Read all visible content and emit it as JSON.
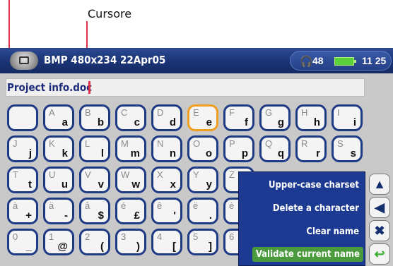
{
  "annotation": {
    "cursor_label": "Cursore",
    "color": "#e0304a"
  },
  "titlebar": {
    "title": "BMP 480x234 22Apr05",
    "volume": "48",
    "time": "11 25",
    "icons": {
      "logo": "archos-logo-icon",
      "headphones": "headphones-icon",
      "battery": "battery-icon"
    }
  },
  "namebar": {
    "filename": "Project info.doc"
  },
  "keyboard": {
    "rows": [
      [
        {
          "up": "",
          "lo": ""
        },
        {
          "up": "A",
          "lo": "a"
        },
        {
          "up": "B",
          "lo": "b"
        },
        {
          "up": "C",
          "lo": "c"
        },
        {
          "up": "D",
          "lo": "d"
        },
        {
          "up": "E",
          "lo": "e",
          "selected": true
        },
        {
          "up": "F",
          "lo": "f"
        },
        {
          "up": "G",
          "lo": "g"
        },
        {
          "up": "H",
          "lo": "h"
        },
        {
          "up": "I",
          "lo": "i"
        }
      ],
      [
        {
          "up": "J",
          "lo": "j"
        },
        {
          "up": "K",
          "lo": "k"
        },
        {
          "up": "L",
          "lo": "l"
        },
        {
          "up": "M",
          "lo": "m"
        },
        {
          "up": "N",
          "lo": "n"
        },
        {
          "up": "O",
          "lo": "o"
        },
        {
          "up": "P",
          "lo": "p"
        },
        {
          "up": "Q",
          "lo": "q"
        },
        {
          "up": "R",
          "lo": "r"
        },
        {
          "up": "S",
          "lo": "s"
        }
      ],
      [
        {
          "up": "T",
          "lo": "t"
        },
        {
          "up": "U",
          "lo": "u"
        },
        {
          "up": "V",
          "lo": "v"
        },
        {
          "up": "W",
          "lo": "w"
        },
        {
          "up": "X",
          "lo": "x"
        },
        {
          "up": "Y",
          "lo": "y"
        },
        {
          "up": "Z",
          "lo": ""
        }
      ],
      [
        {
          "up": "à",
          "lo": "+"
        },
        {
          "up": "ä",
          "lo": "-"
        },
        {
          "up": "â",
          "lo": "$"
        },
        {
          "up": "é",
          "lo": "£"
        },
        {
          "up": "ê",
          "lo": "'"
        },
        {
          "up": "ë",
          "lo": "."
        },
        {
          "up": "è",
          "lo": ""
        }
      ],
      [
        {
          "up": "0",
          "lo": "_"
        },
        {
          "up": "1",
          "lo": "@"
        },
        {
          "up": "2",
          "lo": "("
        },
        {
          "up": "3",
          "lo": ")"
        },
        {
          "up": "4",
          "lo": "["
        },
        {
          "up": "5",
          "lo": "]"
        },
        {
          "up": "6",
          "lo": ""
        }
      ]
    ]
  },
  "menu": {
    "items": [
      {
        "label": "Upper-case charset"
      },
      {
        "label": "Delete a character"
      },
      {
        "label": "Clear name"
      },
      {
        "label": "Validate current name",
        "active": true
      }
    ]
  },
  "side_buttons": [
    {
      "name": "up-arrow-icon",
      "glyph": "▲"
    },
    {
      "name": "left-arrow-icon",
      "glyph": "◀"
    },
    {
      "name": "close-x-icon",
      "glyph": "✖"
    },
    {
      "name": "return-arrow-icon",
      "glyph": "↩",
      "green": true
    }
  ]
}
